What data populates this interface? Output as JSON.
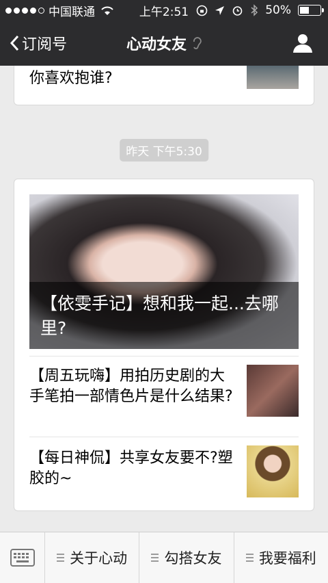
{
  "status": {
    "carrier": "中国联通",
    "time": "上午2:51",
    "battery": "50%",
    "battery_level": 0.5
  },
  "nav": {
    "back_label": "订阅号",
    "title": "心动女友"
  },
  "prev_card": {
    "title": "你喜欢抱谁?"
  },
  "timestamp": "昨天 下午5:30",
  "article": {
    "hero_title": "【依雯手记】想和我一起...去哪里?",
    "items": [
      {
        "title": "【周五玩嗨】用拍历史剧的大手笔拍一部情色片是什么结果?"
      },
      {
        "title": "【每日神侃】共享女友要不?塑胶的~"
      }
    ]
  },
  "menu": {
    "items": [
      "关于心动",
      "勾搭女友",
      "我要福利"
    ]
  },
  "icons": {
    "back": "chevron-left-icon",
    "ear": "ear-icon",
    "profile": "person-icon",
    "keyboard": "keyboard-icon",
    "wifi": "wifi-icon",
    "lock": "rotation-lock-icon",
    "location": "location-arrow-icon",
    "alarm": "alarm-icon",
    "bluetooth": "bluetooth-icon"
  }
}
